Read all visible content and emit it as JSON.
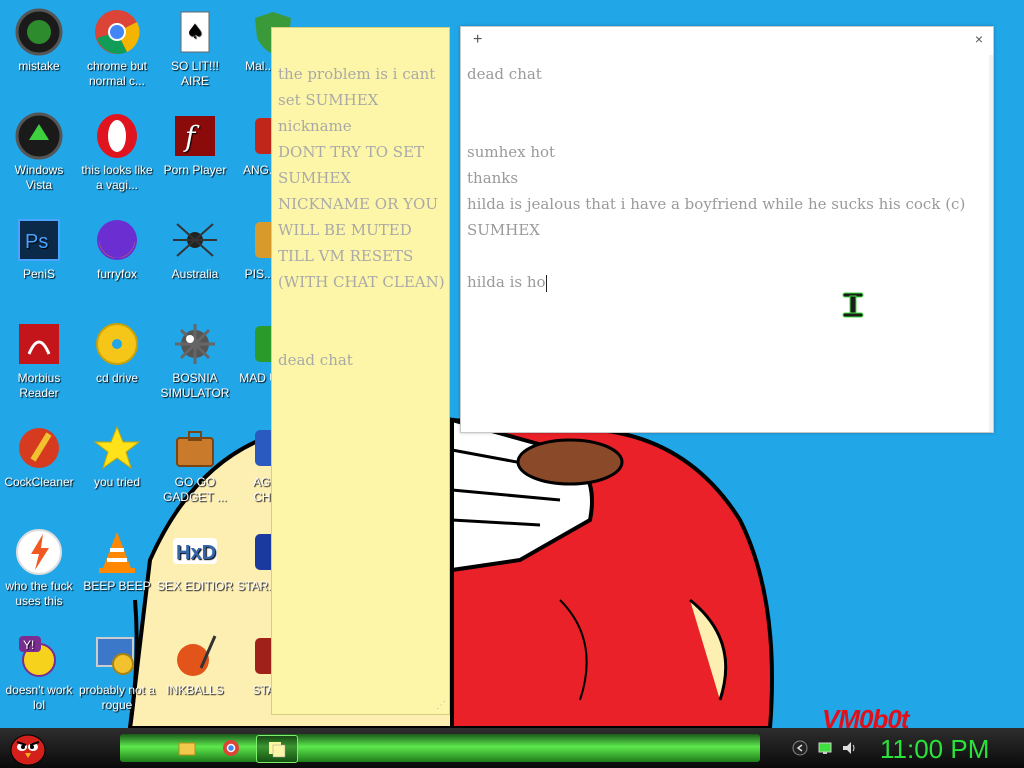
{
  "desktop": {
    "icons": [
      {
        "label": "mistake"
      },
      {
        "label": "chrome but normal c..."
      },
      {
        "label": "SO LIT!!! AIRE"
      },
      {
        "label": "Mal... By..."
      },
      {
        "label": "Windows Vista"
      },
      {
        "label": "this looks like a vagi..."
      },
      {
        "label": "Porn Player"
      },
      {
        "label": "ANG... Bl..."
      },
      {
        "label": "PeniS"
      },
      {
        "label": "furryfox"
      },
      {
        "label": "Australia"
      },
      {
        "label": "PIS... OFF"
      },
      {
        "label": "Morbius Reader"
      },
      {
        "label": "cd drive"
      },
      {
        "label": "BOSNIA SIMULATOR"
      },
      {
        "label": "MAD UNIV..."
      },
      {
        "label": "CockCleaner"
      },
      {
        "label": "you tried"
      },
      {
        "label": "GO GO GADGET ..."
      },
      {
        "label": "AGGI... CHIC..."
      },
      {
        "label": "who the fuck uses this"
      },
      {
        "label": "BEEP BEEP"
      },
      {
        "label": "SEX EDITIOR"
      },
      {
        "label": "STAR... GA..."
      },
      {
        "label": "doesn't work lol"
      },
      {
        "label": "probably not a rogue"
      },
      {
        "label": "INKBALLS"
      },
      {
        "label": "STAR..."
      }
    ],
    "watermark": "VM0b0t"
  },
  "sticky_note": {
    "text": "the problem is i cant set SUMHEX nickname\nDONT TRY TO SET SUMHEX NICKNAME OR YOU WILL BE MUTED TILL VM RESETS (WITH CHAT CLEAN)\n\n\ndead chat"
  },
  "note_window": {
    "add_label": "+",
    "close_label": "×",
    "lines": [
      "dead chat",
      "",
      "",
      "sumhex hot",
      "thanks",
      "hilda is jealous that i have a boyfriend while he sucks his cock (c)",
      "SUMHEX",
      "",
      "hilda is ho"
    ]
  },
  "taskbar": {
    "clock": "11:00 PM"
  }
}
